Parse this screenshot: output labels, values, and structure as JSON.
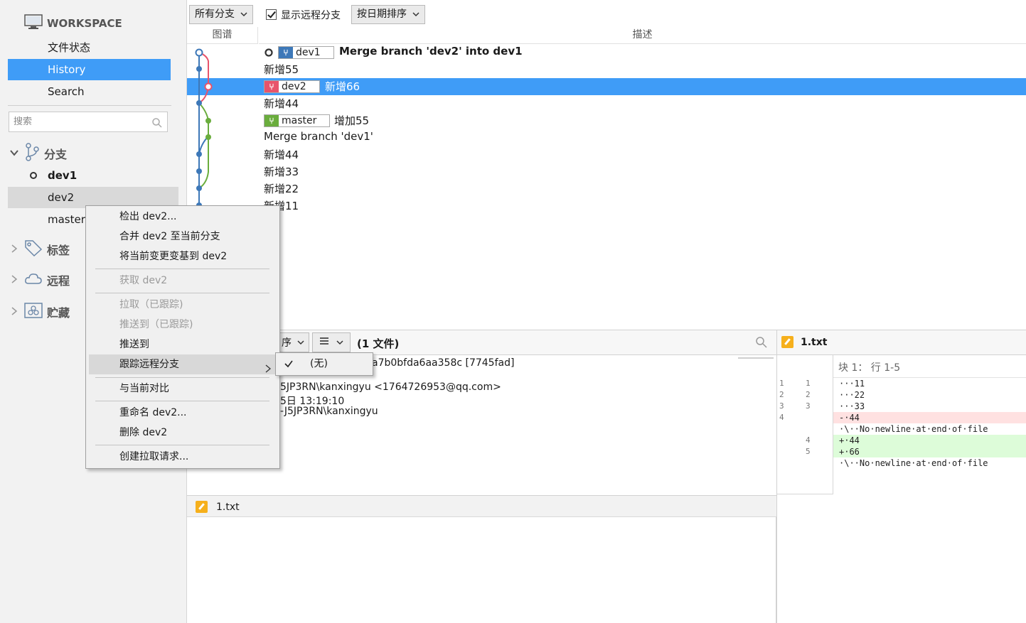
{
  "sidebar": {
    "workspace_title": "WORKSPACE",
    "nav": [
      "文件状态",
      "History",
      "Search"
    ],
    "search_placeholder": "搜索",
    "sections": {
      "branches": "分支",
      "tags": "标签",
      "remotes": "远程",
      "stashes": "贮藏"
    },
    "branches": [
      "dev1",
      "dev2",
      "master"
    ]
  },
  "toolbar": {
    "branches_filter": "所有分支",
    "show_remote": "显示远程分支",
    "sort": "按日期排序"
  },
  "table": {
    "headers": {
      "graph": "图谱",
      "description": "描述"
    },
    "rows": [
      {
        "tag": "dev1",
        "message": "Merge branch 'dev2' into dev1"
      },
      {
        "tag": "",
        "message": "新增55"
      },
      {
        "tag": "dev2",
        "message": "新增66"
      },
      {
        "tag": "",
        "message": "新增44"
      },
      {
        "tag": "master",
        "message": "增加55"
      },
      {
        "tag": "",
        "message": "Merge branch 'dev1'"
      },
      {
        "tag": "",
        "message": "新增44"
      },
      {
        "tag": "",
        "message": "新增33"
      },
      {
        "tag": "",
        "message": "新增22"
      },
      {
        "tag": "",
        "message": "新增11"
      }
    ]
  },
  "details": {
    "sort_partial": "序",
    "file_count": "(1 文件)",
    "commit_hash_partial": "a7b0bfda6aa358c [7745fad]",
    "author_partial": "5JP3RN\\kanxingyu <1764726953@qq.com>",
    "date_partial": "5日 13:19:10",
    "committer_partial": "-J5JP3RN\\kanxingyu",
    "files": [
      "1.txt"
    ]
  },
  "diff": {
    "file_name": "1.txt",
    "hunk_header": "块 1： 行 1-5",
    "lines": [
      {
        "old": "1",
        "new": "1",
        "text": "···11",
        "kind": "ctx"
      },
      {
        "old": "2",
        "new": "2",
        "text": "···22",
        "kind": "ctx"
      },
      {
        "old": "3",
        "new": "3",
        "text": "···33",
        "kind": "ctx"
      },
      {
        "old": "4",
        "new": "",
        "text": "-·44",
        "kind": "del"
      },
      {
        "old": "",
        "new": "",
        "text": "·\\··No·newline·at·end·of·file",
        "kind": "ctx"
      },
      {
        "old": "",
        "new": "4",
        "text": "+·44",
        "kind": "add"
      },
      {
        "old": "",
        "new": "5",
        "text": "+·66",
        "kind": "add"
      },
      {
        "old": "",
        "new": "",
        "text": "·\\··No·newline·at·end·of·file",
        "kind": "ctx"
      }
    ]
  },
  "context_menu": {
    "items": [
      "检出 dev2...",
      "合并 dev2 至当前分支",
      "将当前变更变基到 dev2",
      "获取 dev2",
      "拉取（已跟踪)",
      "推送到（已跟踪)",
      "推送到",
      "跟踪远程分支",
      "与当前对比",
      "重命名 dev2...",
      "删除 dev2",
      "创建拉取请求..."
    ],
    "submenu": {
      "none_option": "(无)"
    }
  },
  "colors": {
    "accent": "#3f9cf7",
    "dev1": "#3d78b8",
    "dev2": "#e8546b",
    "master": "#6aad3d"
  }
}
